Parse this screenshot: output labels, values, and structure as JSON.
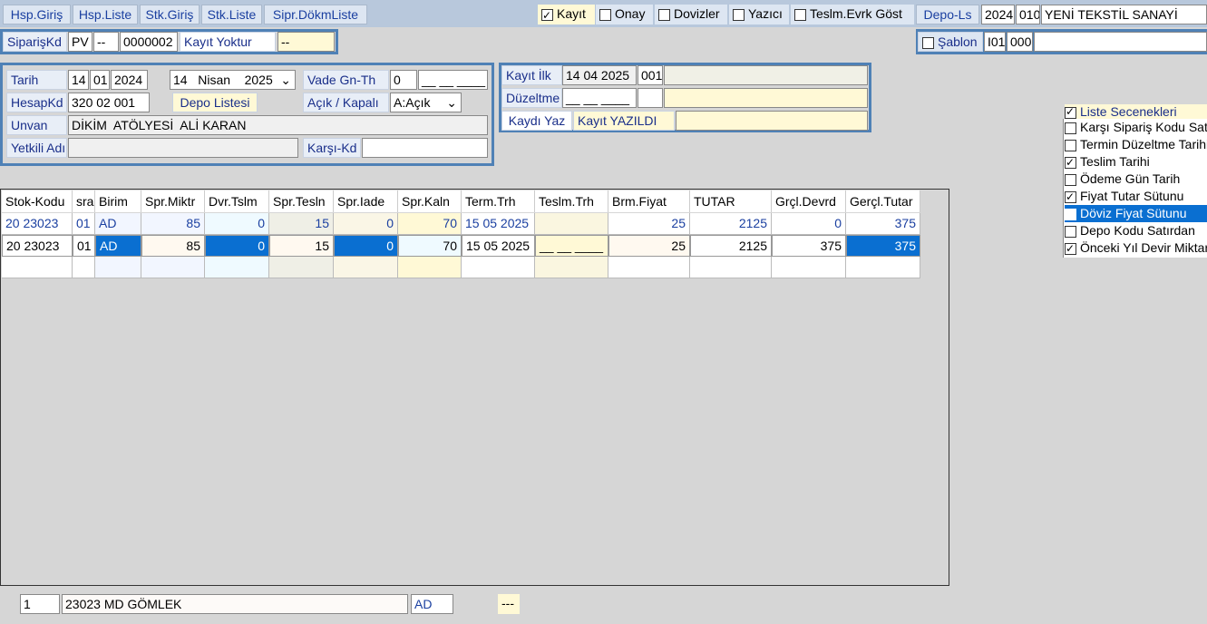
{
  "toolbar": {
    "buttons": [
      "Hsp.Giriş",
      "Hsp.Liste",
      "Stk.Giriş",
      "Stk.Liste",
      "Sipr.DökmListe"
    ],
    "checks": [
      {
        "label": "Kayıt",
        "checked": true
      },
      {
        "label": "Onay",
        "checked": false
      },
      {
        "label": "Dovizler",
        "checked": false
      },
      {
        "label": "Yazıcı",
        "checked": false
      },
      {
        "label": "Teslm.Evrk Göst",
        "checked": false
      }
    ],
    "depo_button": "Depo-Ls",
    "year": "2024",
    "code": "010",
    "company": "YENİ TEKSTİL SANAYİ"
  },
  "order": {
    "label": "SiparişKd",
    "prefix": "PV",
    "dash": "--",
    "number": "0000002",
    "status": "Kayıt Yoktur",
    "status_value": "--"
  },
  "template": {
    "label": "Şablon",
    "checked": false,
    "val1": "I01",
    "val2": "000",
    "val3": ""
  },
  "form": {
    "tarih_label": "Tarih",
    "tarih_day": "14",
    "tarih_month": "01",
    "tarih_year": "2024",
    "date_select": "14   Nisan    2025",
    "vade_label": "Vade Gn-Th",
    "vade_value": "0",
    "vade_date": "__ __ ____",
    "hesap_label": "HesapKd",
    "hesap_value": "320 02 001",
    "depo_button": "Depo Listesi",
    "acik_label": "Açık / Kapalı",
    "acik_value": "A:Açık",
    "unvan_label": "Unvan",
    "unvan_value": "DİKİM  ATÖLYESİ  ALİ KARAN",
    "yetkili_label": "Yetkili Adı",
    "yetkili_value": "",
    "karsi_label": "Karşı-Kd",
    "karsi_value": ""
  },
  "record": {
    "ilk_label": "Kayıt İlk",
    "ilk_date": "14 04 2025",
    "ilk_code": "001",
    "duzeltme_label": "Düzeltme",
    "duzeltme_date": "__ __ ____",
    "yaz_button": "Kaydı Yaz",
    "yaz_status": "Kayıt YAZILDI"
  },
  "options": {
    "header": "Liste Secenekleri",
    "header_checked": true,
    "items": [
      {
        "label": "Karşı Sipariş Kodu Satırda",
        "checked": false,
        "highlight": false
      },
      {
        "label": "Termin Düzeltme Tarihi",
        "checked": false,
        "highlight": false
      },
      {
        "label": "Teslim Tarihi",
        "checked": true,
        "highlight": false
      },
      {
        "label": "Ödeme Gün Tarih",
        "checked": false,
        "highlight": false
      },
      {
        "label": "Fiyat Tutar Sütunu",
        "checked": true,
        "highlight": false
      },
      {
        "label": "Döviz Fiyat Sütunu",
        "checked": false,
        "highlight": true
      },
      {
        "label": "Depo Kodu Satırdan",
        "checked": false,
        "highlight": false
      },
      {
        "label": "Önceki Yıl Devir Miktarı",
        "checked": true,
        "highlight": false
      }
    ]
  },
  "table": {
    "columns": [
      "Stok-Kodu",
      "sra",
      "Birim",
      "Spr.Miktr",
      "Dvr.Tslm",
      "Spr.Tesln",
      "Spr.Iade",
      "Spr.Kaln",
      "Term.Trh",
      "Teslm.Trh",
      "Brm.Fiyat",
      "TUTAR",
      "Grçl.Devrd",
      "Gerçl.Tutar"
    ],
    "rows": [
      [
        "20 23023",
        "01",
        "AD",
        "85",
        "0",
        "15",
        "0",
        "70",
        "15 05 2025",
        "",
        "25",
        "2125",
        "0",
        "375"
      ],
      [
        "20 23023",
        "01",
        "AD",
        "85",
        "0",
        "15",
        "0",
        "70",
        "15 05 2025",
        "__ __ ____",
        "25",
        "2125",
        "375",
        "375"
      ]
    ]
  },
  "footer": {
    "index": "1",
    "product": "23023 MD GÖMLEK",
    "unit": "AD",
    "extra": "---"
  }
}
